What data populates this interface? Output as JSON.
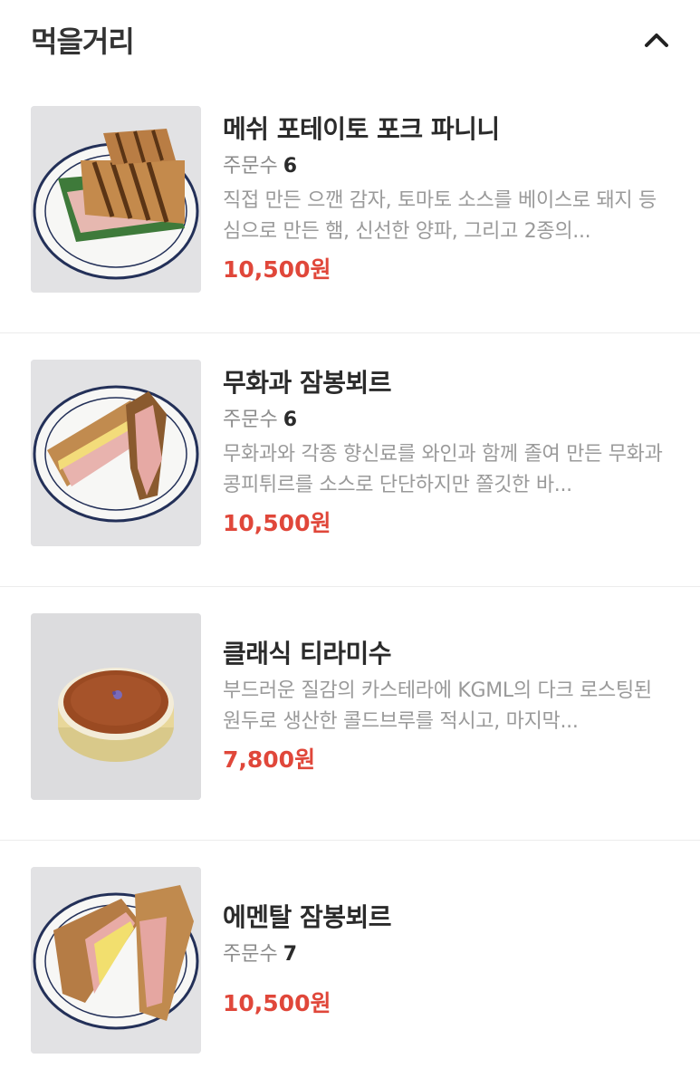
{
  "section": {
    "title": "먹을거리",
    "toggle_icon": "chevron-up-icon"
  },
  "colors": {
    "price": "#e0473a",
    "title": "#2b2b2b",
    "muted": "#9a9a9a",
    "divider": "#ececec"
  },
  "items": [
    {
      "name": "메쉬 포테이토 포크 파니니",
      "order_label": "주문수",
      "order_count": "6",
      "description": "직접 만든 으깬 감자, 토마토 소스를 베이스로 돼지 등심으로 만든 햄, 신선한 양파, 그리고 2종의...",
      "price": "10,500원",
      "image": "panini-plate"
    },
    {
      "name": "무화과 잠봉뵈르",
      "order_label": "주문수",
      "order_count": "6",
      "description": "무화과와 각종 향신료를 와인과 함께 졸여 만든 무화과 콩피튀르를 소스로 단단하지만 쫄깃한 바...",
      "price": "10,500원",
      "image": "sandwich-plate"
    },
    {
      "name": "클래식 티라미수",
      "order_label": "",
      "order_count": "",
      "description": "부드러운 질감의 카스테라에 KGML의 다크 로스팅된 원두로 생산한 콜드브루를 적시고, 마지막...",
      "price": "7,800원",
      "image": "tiramisu-bowl"
    },
    {
      "name": "에멘탈 잠봉뵈르",
      "order_label": "주문수",
      "order_count": "7",
      "description": "",
      "price": "10,500원",
      "image": "sandwich-plate-2"
    }
  ]
}
